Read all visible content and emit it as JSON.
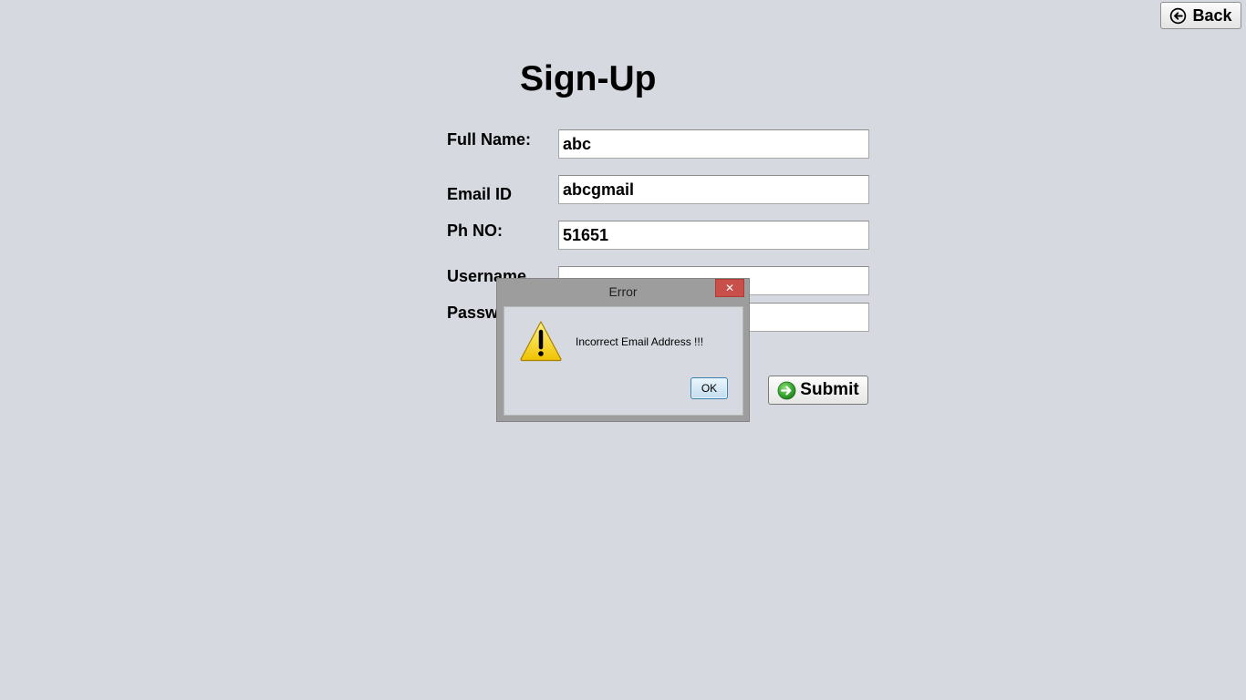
{
  "header": {
    "back_label": "Back",
    "back_icon": "back-arrow-circle-icon"
  },
  "form": {
    "title": "Sign-Up",
    "fields": {
      "full_name": {
        "label": "Full Name:",
        "value": "abc"
      },
      "email": {
        "label": "Email ID",
        "value": "abcgmail"
      },
      "phone": {
        "label": "Ph NO:",
        "value": "51651"
      },
      "username": {
        "label": "Username",
        "value": ""
      },
      "password": {
        "label": "Passw",
        "value": ""
      }
    },
    "submit_label": "Submit",
    "submit_icon": "green-arrow-circle-icon"
  },
  "dialog": {
    "title": "Error",
    "close_glyph": "✕",
    "message": "Incorrect Email Address !!!",
    "ok_label": "OK",
    "icon": "warning-icon"
  },
  "colors": {
    "background": "#d6d9e0",
    "close_button": "#c9504a",
    "submit_icon_green": "#3aa835",
    "warning_yellow": "#f4d21a"
  }
}
